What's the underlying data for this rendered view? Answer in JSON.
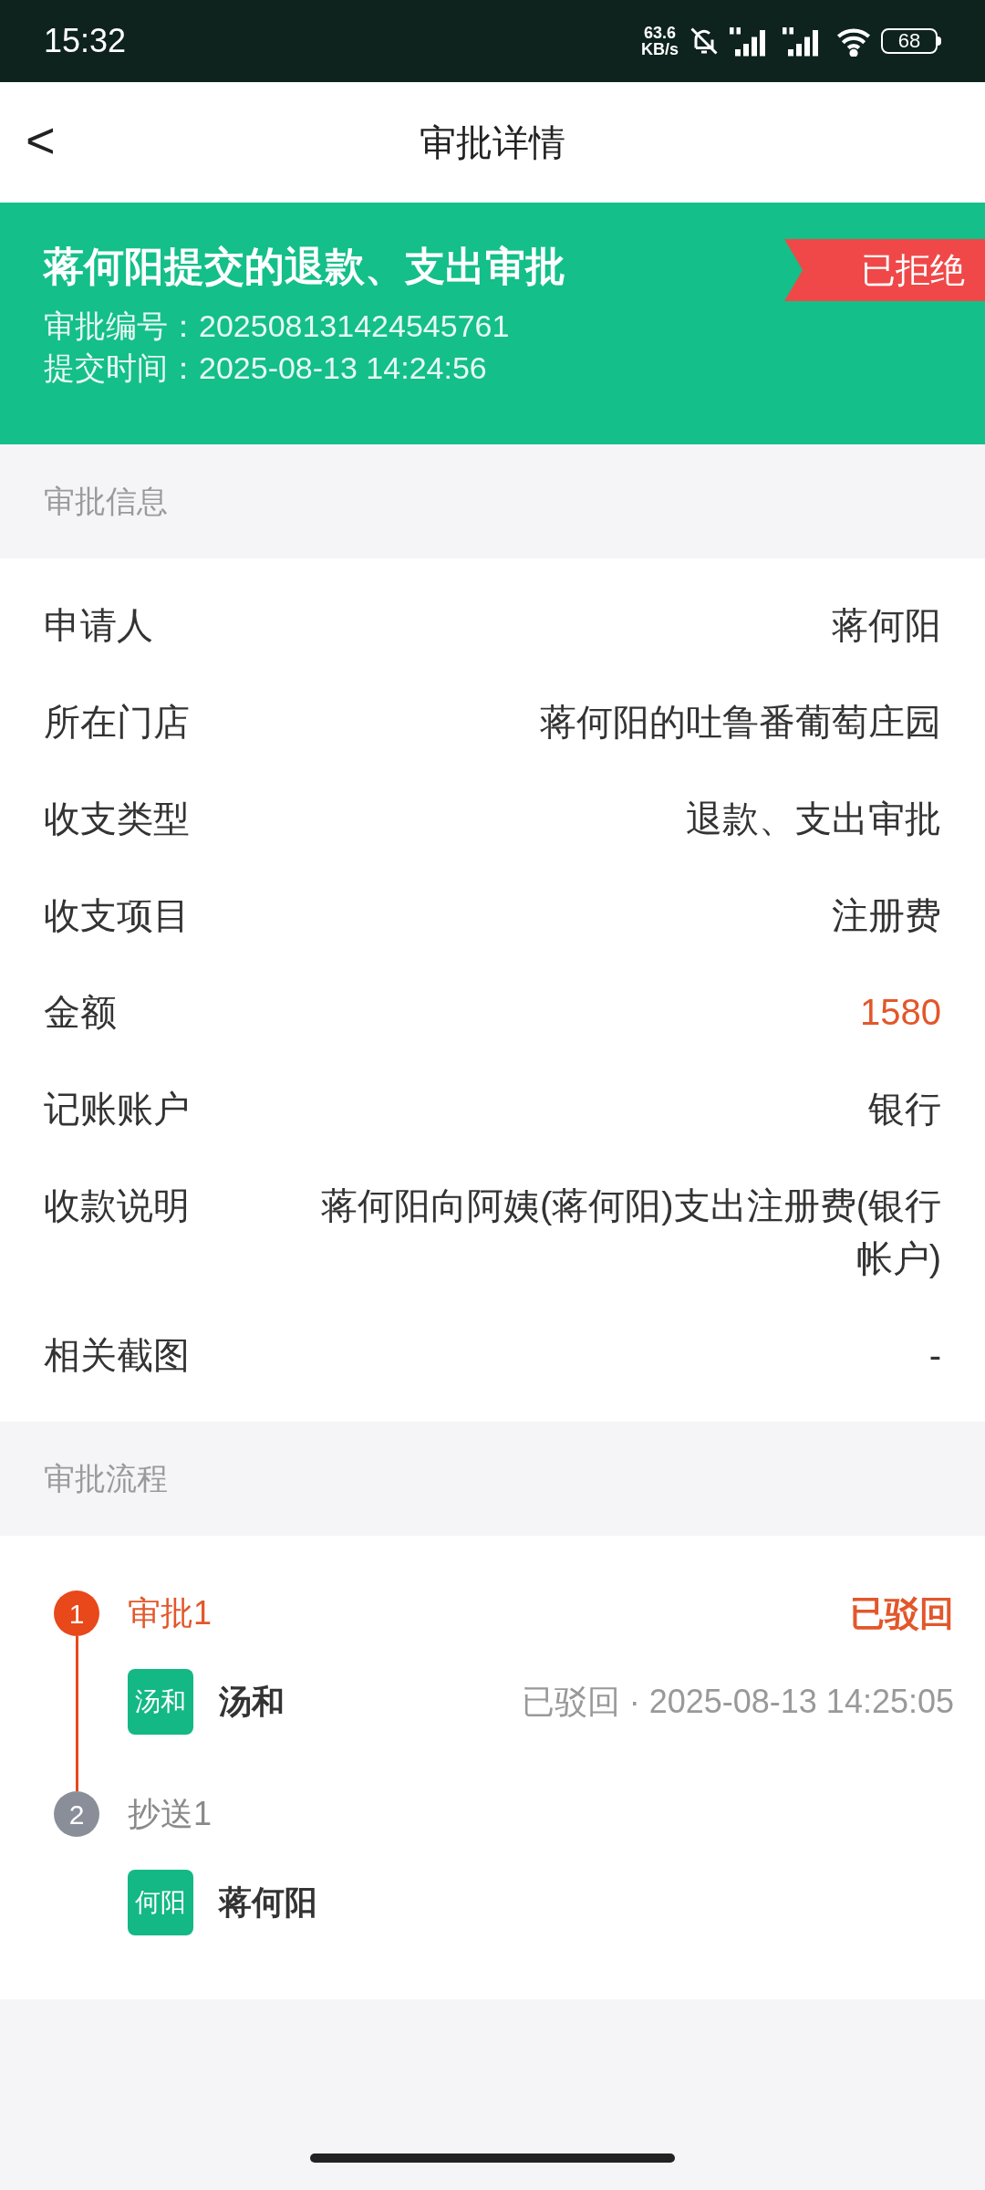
{
  "status_bar": {
    "time": "15:32",
    "net_speed": [
      "63.6",
      "KB/s"
    ],
    "battery": "68"
  },
  "header": {
    "back": "<",
    "title": "审批详情"
  },
  "banner": {
    "title": "蒋何阳提交的退款、支出审批",
    "status": "已拒绝",
    "lines": [
      {
        "label": "审批编号：",
        "value": "202508131424545761"
      },
      {
        "label": "提交时间：",
        "value": "2025-08-13 14:24:56"
      }
    ]
  },
  "info_section": {
    "title": "审批信息",
    "rows": [
      {
        "label": "申请人",
        "value": "蒋何阳",
        "highlight": false
      },
      {
        "label": "所在门店",
        "value": "蒋何阳的吐鲁番葡萄庄园",
        "highlight": false
      },
      {
        "label": "收支类型",
        "value": "退款、支出审批",
        "highlight": false
      },
      {
        "label": "收支项目",
        "value": "注册费",
        "highlight": false
      },
      {
        "label": "金额",
        "value": "1580",
        "highlight": true
      },
      {
        "label": "记账账户",
        "value": "银行",
        "highlight": false
      },
      {
        "label": "收款说明",
        "value": "蒋何阳向阿姨(蒋何阳)支出注册费(银行帐户)",
        "highlight": false
      },
      {
        "label": "相关截图",
        "value": "-",
        "highlight": false
      }
    ]
  },
  "flow_section": {
    "title": "审批流程",
    "steps": [
      {
        "number": "1",
        "name": "审批1",
        "current": true,
        "result": "已驳回",
        "person": {
          "avatar": "汤和",
          "name": "汤和",
          "detail": "已驳回 · 2025-08-13 14:25:05"
        }
      },
      {
        "number": "2",
        "name": "抄送1",
        "current": false,
        "person": {
          "avatar": "何阳",
          "name": "蒋何阳"
        }
      }
    ]
  }
}
